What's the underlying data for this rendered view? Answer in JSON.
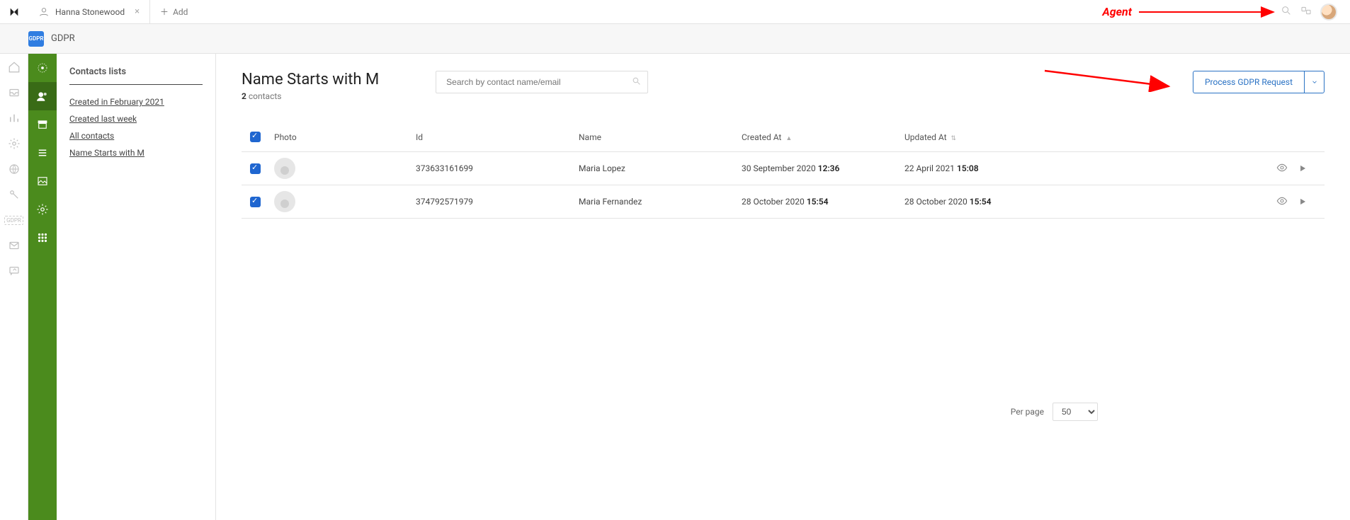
{
  "annotation": {
    "agent_label": "Agent"
  },
  "topbar": {
    "tab_user_name": "Hanna Stonewood",
    "add_label": "Add"
  },
  "appstrip": {
    "module": "GDPR",
    "badge_text": "GDPR"
  },
  "sidebar": {
    "heading": "Contacts lists",
    "items": [
      "Created in February 2021",
      "Created last week",
      "All contacts",
      "Name Starts with M"
    ]
  },
  "main": {
    "title": "Name Starts with M",
    "count": "2",
    "count_suffix": "contacts",
    "search_placeholder": "Search by contact name/email",
    "process_label": "Process GDPR Request"
  },
  "table": {
    "headers": {
      "photo": "Photo",
      "id": "Id",
      "name": "Name",
      "created": "Created At",
      "updated": "Updated At"
    },
    "rows": [
      {
        "id": "373633161699",
        "name": "Maria Lopez",
        "created_date": "30 September 2020",
        "created_time": "12:36",
        "updated_date": "22 April 2021",
        "updated_time": "15:08"
      },
      {
        "id": "374792571979",
        "name": "Maria Fernandez",
        "created_date": "28 October 2020",
        "created_time": "15:54",
        "updated_date": "28 October 2020",
        "updated_time": "15:54"
      }
    ]
  },
  "pager": {
    "label": "Per page",
    "value": "50"
  }
}
